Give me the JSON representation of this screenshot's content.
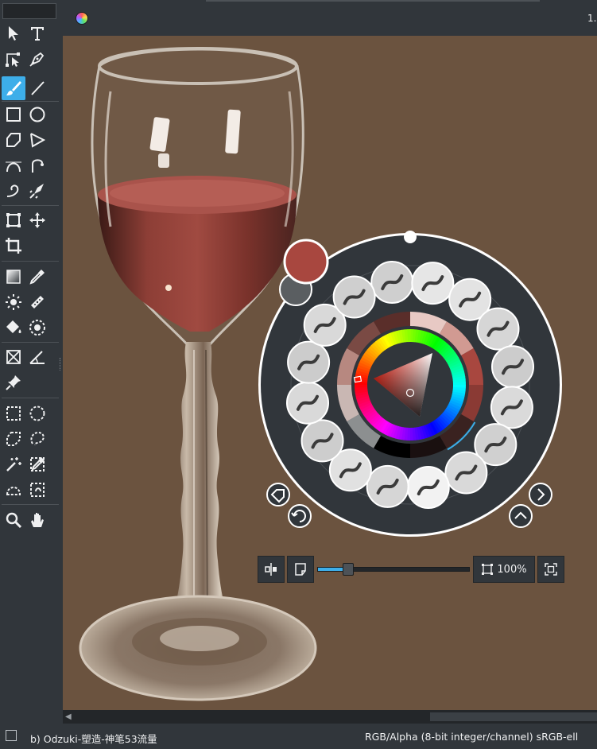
{
  "document": {
    "zoom_label": "1."
  },
  "toolbox": {
    "tools": [
      {
        "name": "select-shapes-tool",
        "icon": "pointer-arrow-icon"
      },
      {
        "name": "text-tool",
        "icon": "text-t-icon"
      },
      {
        "name": "edit-shapes-tool",
        "icon": "edit-shapes-icon"
      },
      {
        "name": "calligraphy-tool",
        "icon": "pen-nib-icon"
      },
      {
        "name": "freehand-brush-tool",
        "icon": "paintbrush-icon",
        "active": true
      },
      {
        "name": "line-tool",
        "icon": "line-icon"
      },
      {
        "name": "rectangle-tool",
        "icon": "rectangle-icon"
      },
      {
        "name": "ellipse-tool",
        "icon": "ellipse-icon"
      },
      {
        "name": "polygon-tool",
        "icon": "polygon-icon"
      },
      {
        "name": "polyline-tool",
        "icon": "polyline-icon"
      },
      {
        "name": "bezier-curve-tool",
        "icon": "bezier-curve-icon"
      },
      {
        "name": "freehand-path-tool",
        "icon": "freehand-path-icon"
      },
      {
        "name": "dynamic-brush-tool",
        "icon": "dynamic-brush-icon"
      },
      {
        "name": "multibrush-tool",
        "icon": "multibrush-icon"
      },
      {
        "name": "transform-tool",
        "icon": "transform-icon"
      },
      {
        "name": "move-tool",
        "icon": "move-arrows-icon"
      },
      {
        "name": "crop-tool",
        "icon": "crop-icon"
      },
      {
        "name": "gradient-tool",
        "icon": "gradient-icon"
      },
      {
        "name": "color-sampler-tool",
        "icon": "eyedropper-icon"
      },
      {
        "name": "colorize-mask-tool",
        "icon": "colorize-mask-icon"
      },
      {
        "name": "smart-patch-tool",
        "icon": "smart-patch-icon"
      },
      {
        "name": "fill-tool",
        "icon": "paint-bucket-icon"
      },
      {
        "name": "enclose-fill-tool",
        "icon": "enclose-fill-icon"
      },
      {
        "name": "assistant-tool",
        "icon": "assistant-icon"
      },
      {
        "name": "measure-tool",
        "icon": "measure-angle-icon"
      },
      {
        "name": "reference-images-tool",
        "icon": "pin-icon"
      },
      {
        "name": "rectangular-selection-tool",
        "icon": "rect-select-icon"
      },
      {
        "name": "elliptical-selection-tool",
        "icon": "ellipse-select-icon"
      },
      {
        "name": "polygonal-selection-tool",
        "icon": "polygon-select-icon"
      },
      {
        "name": "freehand-selection-tool",
        "icon": "lasso-icon"
      },
      {
        "name": "contiguous-selection-tool",
        "icon": "magic-wand-icon"
      },
      {
        "name": "similar-color-selection-tool",
        "icon": "similar-select-icon"
      },
      {
        "name": "bezier-selection-tool",
        "icon": "bezier-select-icon"
      },
      {
        "name": "magnetic-selection-tool",
        "icon": "magnetic-select-icon"
      },
      {
        "name": "zoom-tool",
        "icon": "magnifier-icon"
      },
      {
        "name": "pan-tool",
        "icon": "hand-icon"
      }
    ]
  },
  "popup_palette": {
    "foreground_color": "#a8473f",
    "background_color": "#5a5e61",
    "ring_color": "#31363b",
    "accent": "#3daee9",
    "presets": [
      {
        "name": "brush-preset-1",
        "icon": "brush-stroke-icon"
      },
      {
        "name": "brush-preset-2",
        "icon": "brush-stroke-icon"
      },
      {
        "name": "brush-preset-3",
        "icon": "brush-stroke-icon"
      },
      {
        "name": "brush-preset-4",
        "icon": "airbrush-icon"
      },
      {
        "name": "brush-preset-5",
        "icon": "blender-brush-icon"
      },
      {
        "name": "brush-preset-6",
        "icon": "airbrush-icon"
      },
      {
        "name": "brush-preset-7",
        "icon": "texture-brush-icon"
      },
      {
        "name": "brush-preset-8",
        "icon": "brush-stroke-icon"
      },
      {
        "name": "brush-preset-9",
        "icon": "soft-round-brush-icon"
      },
      {
        "name": "brush-preset-10",
        "icon": "ink-brush-icon"
      },
      {
        "name": "brush-preset-11",
        "icon": "pencil-icon"
      },
      {
        "name": "brush-preset-12",
        "icon": "marker-icon"
      },
      {
        "name": "brush-preset-13",
        "icon": "paintbrush-icon"
      },
      {
        "name": "brush-preset-14",
        "icon": "flat-brush-icon"
      },
      {
        "name": "brush-preset-15",
        "icon": "wet-brush-icon"
      },
      {
        "name": "brush-preset-16",
        "icon": "paintbrush-icon"
      }
    ],
    "recent_colors": [
      "#e8c9c4",
      "#d19a92",
      "#a8473f",
      "#8a3a34",
      "#3a2220",
      "#1a1010",
      "#000000",
      "#8c8f90",
      "#c9b7b3",
      "#b78880",
      "#7a4a44",
      "#5a2e2a"
    ],
    "tag_icon": "tag-icon",
    "refresh_icon": "refresh-icon",
    "next_icon": "chevron-right-icon",
    "expand_icon": "chevron-up-icon",
    "handle_icon": "drag-handle-icon"
  },
  "canvas_controls": {
    "mirror_icon": "mirror-view-icon",
    "canvas_only_icon": "canvas-only-icon",
    "zoom_percent": 0.2,
    "zoom_label": "100%",
    "fit_icon": "fit-to-view-icon",
    "reset_icon": "reset-zoom-icon"
  },
  "status": {
    "brush_name": "b) Odzuki-塑造-神笔53流量",
    "color_info": "RGB/Alpha (8-bit integer/channel)  sRGB-ell"
  }
}
